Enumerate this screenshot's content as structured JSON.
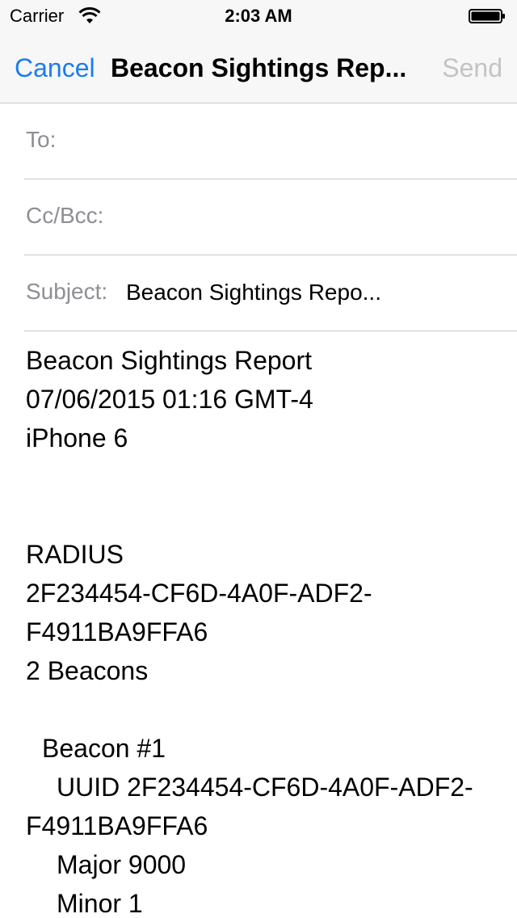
{
  "status_bar": {
    "carrier": "Carrier",
    "time": "2:03 AM",
    "wifi_icon": "wifi-icon",
    "battery_icon": "battery-icon"
  },
  "nav": {
    "cancel_label": "Cancel",
    "title": "Beacon Sightings Rep...",
    "send_label": "Send",
    "accent_color": "#1a7cf2",
    "disabled_color": "#c4c4c4"
  },
  "fields": {
    "to_label": "To:",
    "to_value": "",
    "cc_label": "Cc/Bcc:",
    "cc_value": "",
    "subject_label": "Subject:",
    "subject_value": "Beacon Sightings Repo..."
  },
  "body": {
    "lines": [
      "Beacon Sightings Report",
      "07/06/2015 01:16 GMT-4",
      "iPhone 6",
      "",
      "",
      "RADIUS",
      "2F234454-CF6D-4A0F-ADF2-",
      "F4911BA9FFA6",
      "2 Beacons",
      "",
      "  Beacon #1",
      "    UUID 2F234454-CF6D-4A0F-ADF2-",
      "F4911BA9FFA6",
      "    Major 9000",
      "    Minor 1"
    ]
  }
}
